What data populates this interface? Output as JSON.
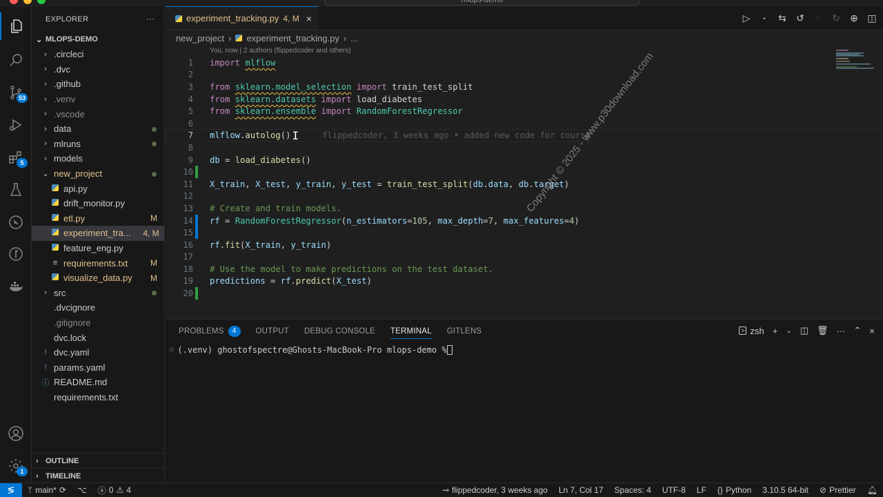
{
  "titlebar": {
    "command_center": "mlops-demo"
  },
  "activity": {
    "scm_badge": "53",
    "extensions_badge": "5",
    "settings_badge": "1"
  },
  "sidebar": {
    "title": "EXPLORER",
    "more": "···",
    "folder": "MLOPS-DEMO",
    "items": [
      {
        "name": ".circleci",
        "kind": "folder",
        "deco": ""
      },
      {
        "name": ".dvc",
        "kind": "folder",
        "deco": ""
      },
      {
        "name": ".github",
        "kind": "folder",
        "deco": ""
      },
      {
        "name": ".venv",
        "kind": "folder",
        "deco": ""
      },
      {
        "name": ".vscode",
        "kind": "folder",
        "deco": ""
      },
      {
        "name": "data",
        "kind": "folder",
        "deco": "dot"
      },
      {
        "name": "mlruns",
        "kind": "folder",
        "deco": "dot"
      },
      {
        "name": "models",
        "kind": "folder",
        "deco": ""
      },
      {
        "name": "new_project",
        "kind": "folder-open",
        "deco": "dot"
      },
      {
        "name": "api.py",
        "kind": "py",
        "deco": ""
      },
      {
        "name": "drift_monitor.py",
        "kind": "py",
        "deco": ""
      },
      {
        "name": "etl.py",
        "kind": "py",
        "deco": "M"
      },
      {
        "name": "experiment_tra...",
        "kind": "py",
        "deco": "4, M"
      },
      {
        "name": "feature_eng.py",
        "kind": "py",
        "deco": ""
      },
      {
        "name": "requirements.txt",
        "kind": "txt",
        "deco": "M"
      },
      {
        "name": "visualize_data.py",
        "kind": "py",
        "deco": "M"
      },
      {
        "name": "src",
        "kind": "folder",
        "deco": "dot"
      },
      {
        "name": ".dvcignore",
        "kind": "file",
        "deco": ""
      },
      {
        "name": ".gitignore",
        "kind": "file",
        "deco": ""
      },
      {
        "name": "dvc.lock",
        "kind": "file",
        "deco": ""
      },
      {
        "name": "dvc.yaml",
        "kind": "yaml",
        "deco": ""
      },
      {
        "name": "params.yaml",
        "kind": "yaml",
        "deco": ""
      },
      {
        "name": "README.md",
        "kind": "info",
        "deco": ""
      },
      {
        "name": "requirements.txt",
        "kind": "file",
        "deco": ""
      }
    ],
    "outline": "OUTLINE",
    "timeline": "TIMELINE"
  },
  "editor": {
    "tab_name": "experiment_tracking.py",
    "tab_flags": "4, M",
    "breadcrumb": [
      "new_project",
      "experiment_tracking.py",
      "..."
    ],
    "codelens": "You, now | 2 authors (flippedcoder and others)",
    "blame": "flippedcoder, 3 weeks ago • added new code for course",
    "lines": [
      {
        "n": "1",
        "tokens": [
          [
            "kw",
            "import "
          ],
          [
            "mod",
            "mlflow"
          ]
        ]
      },
      {
        "n": "2",
        "tokens": []
      },
      {
        "n": "3",
        "tokens": [
          [
            "kw",
            "from "
          ],
          [
            "mod",
            "sklearn.model_selection"
          ],
          [
            "kw",
            " import "
          ],
          [
            "pl",
            "train_test_split"
          ]
        ]
      },
      {
        "n": "4",
        "tokens": [
          [
            "kw",
            "from "
          ],
          [
            "mod",
            "sklearn.datasets"
          ],
          [
            "kw",
            " import "
          ],
          [
            "pl",
            "load_diabetes"
          ]
        ]
      },
      {
        "n": "5",
        "tokens": [
          [
            "kw",
            "from "
          ],
          [
            "mod",
            "sklearn.ensemble"
          ],
          [
            "kw",
            " import "
          ],
          [
            "cls",
            "RandomForestRegressor"
          ]
        ]
      },
      {
        "n": "6",
        "tokens": []
      },
      {
        "n": "7",
        "tokens": [
          [
            "var",
            "mlflow"
          ],
          [
            "pl",
            "."
          ],
          [
            "fn",
            "autolog"
          ],
          [
            "pl",
            "()"
          ]
        ]
      },
      {
        "n": "8",
        "tokens": []
      },
      {
        "n": "9",
        "tokens": [
          [
            "var",
            "db"
          ],
          [
            "pl",
            " = "
          ],
          [
            "fn",
            "load_diabetes"
          ],
          [
            "pl",
            "()"
          ]
        ]
      },
      {
        "n": "10",
        "tokens": []
      },
      {
        "n": "11",
        "tokens": [
          [
            "var",
            "X_train"
          ],
          [
            "pl",
            ", "
          ],
          [
            "var",
            "X_test"
          ],
          [
            "pl",
            ", "
          ],
          [
            "var",
            "y_train"
          ],
          [
            "pl",
            ", "
          ],
          [
            "var",
            "y_test"
          ],
          [
            "pl",
            " = "
          ],
          [
            "fn",
            "train_test_split"
          ],
          [
            "pl",
            "("
          ],
          [
            "var",
            "db"
          ],
          [
            "pl",
            "."
          ],
          [
            "var",
            "data"
          ],
          [
            "pl",
            ", "
          ],
          [
            "var",
            "db"
          ],
          [
            "pl",
            "."
          ],
          [
            "var",
            "target"
          ],
          [
            "pl",
            ")"
          ]
        ]
      },
      {
        "n": "12",
        "tokens": []
      },
      {
        "n": "13",
        "tokens": [
          [
            "cmt",
            "# Create and train models."
          ]
        ]
      },
      {
        "n": "14",
        "tokens": [
          [
            "var",
            "rf"
          ],
          [
            "pl",
            " = "
          ],
          [
            "cls",
            "RandomForestRegressor"
          ],
          [
            "pl",
            "("
          ],
          [
            "var",
            "n_estimators"
          ],
          [
            "pl",
            "="
          ],
          [
            "num",
            "105"
          ],
          [
            "pl",
            ", "
          ],
          [
            "var",
            "max_depth"
          ],
          [
            "pl",
            "="
          ],
          [
            "num",
            "7"
          ],
          [
            "pl",
            ", "
          ],
          [
            "var",
            "max_features"
          ],
          [
            "pl",
            "="
          ],
          [
            "num",
            "4"
          ],
          [
            "pl",
            ")"
          ]
        ]
      },
      {
        "n": "15",
        "tokens": []
      },
      {
        "n": "16",
        "tokens": [
          [
            "var",
            "rf"
          ],
          [
            "pl",
            "."
          ],
          [
            "fn",
            "fit"
          ],
          [
            "pl",
            "("
          ],
          [
            "var",
            "X_train"
          ],
          [
            "pl",
            ", "
          ],
          [
            "var",
            "y_train"
          ],
          [
            "pl",
            ")"
          ]
        ]
      },
      {
        "n": "17",
        "tokens": []
      },
      {
        "n": "18",
        "tokens": [
          [
            "cmt",
            "# Use the model to make predictions on the test dataset."
          ]
        ]
      },
      {
        "n": "19",
        "tokens": [
          [
            "var",
            "predictions"
          ],
          [
            "pl",
            " = "
          ],
          [
            "var",
            "rf"
          ],
          [
            "pl",
            "."
          ],
          [
            "fn",
            "predict"
          ],
          [
            "pl",
            "("
          ],
          [
            "var",
            "X_test"
          ],
          [
            "pl",
            ")"
          ]
        ]
      },
      {
        "n": "20",
        "tokens": []
      }
    ],
    "watermark": "Copyright © 2025 - www.p30download.com"
  },
  "panel": {
    "tabs": [
      "PROBLEMS",
      "OUTPUT",
      "DEBUG CONSOLE",
      "TERMINAL",
      "GITLENS"
    ],
    "problems_count": "4",
    "active_tab": "TERMINAL",
    "shell": "zsh",
    "prompt": "(.venv) ghostofspectre@Ghosts-MacBook-Pro mlops-demo % "
  },
  "status": {
    "branch": "main*",
    "errors": "0",
    "warnings": "4",
    "blame": "flippedcoder, 3 weeks ago",
    "position": "Ln 7, Col 17",
    "spaces": "Spaces: 4",
    "encoding": "UTF-8",
    "eol": "LF",
    "language": "Python",
    "interpreter": "3.10.5 64-bit",
    "formatter": "Prettier"
  }
}
